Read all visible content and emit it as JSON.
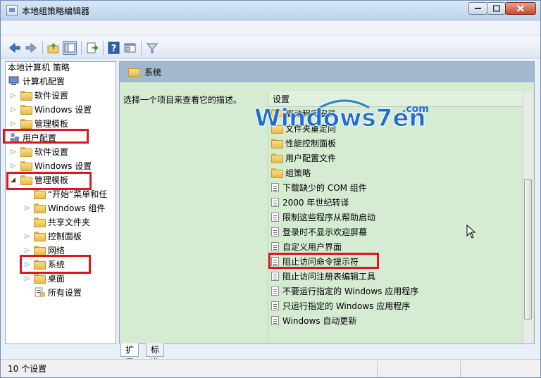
{
  "window": {
    "title": "本地组策略编辑器"
  },
  "tree": {
    "root": "本地计算机 策略",
    "items": [
      {
        "label": "计算机配置"
      },
      {
        "label": "软件设置"
      },
      {
        "label": "Windows 设置"
      },
      {
        "label": "管理模板"
      },
      {
        "label": "用户配置"
      },
      {
        "label": "软件设置"
      },
      {
        "label": "Windows 设置"
      },
      {
        "label": "管理模板"
      },
      {
        "label": "“开始”菜单和任"
      },
      {
        "label": "Windows 组件"
      },
      {
        "label": "共享文件夹"
      },
      {
        "label": "控制面板"
      },
      {
        "label": "网络"
      },
      {
        "label": "系统"
      },
      {
        "label": "桌面"
      },
      {
        "label": "所有设置"
      }
    ]
  },
  "right": {
    "header": "系统",
    "description": "选择一个项目来查看它的描述。",
    "column_header": "设置",
    "partial_item": "驱动程序安装",
    "items": [
      {
        "label": "文件夹重定向",
        "kind": "folder"
      },
      {
        "label": "性能控制面板",
        "kind": "folder"
      },
      {
        "label": "用户配置文件",
        "kind": "folder"
      },
      {
        "label": "组策略",
        "kind": "folder"
      },
      {
        "label": "下载缺少的 COM 组件",
        "kind": "setting"
      },
      {
        "label": "2000 年世纪转译",
        "kind": "setting"
      },
      {
        "label": "限制这些程序从帮助启动",
        "kind": "setting"
      },
      {
        "label": "登录时不显示欢迎屏幕",
        "kind": "setting"
      },
      {
        "label": "自定义用户界面",
        "kind": "setting"
      },
      {
        "label": "阻止访问命令提示符",
        "kind": "setting"
      },
      {
        "label": "阻止访问注册表编辑工具",
        "kind": "setting"
      },
      {
        "label": "不要运行指定的 Windows 应用程序",
        "kind": "setting"
      },
      {
        "label": "只运行指定的 Windows 应用程序",
        "kind": "setting"
      },
      {
        "label": "Windows 自动更新",
        "kind": "setting"
      }
    ]
  },
  "tabs": [
    {
      "label": "扩展"
    },
    {
      "label": "标准"
    }
  ],
  "status": {
    "text": "10 个设置"
  },
  "watermark": {
    "text": "Windows7en",
    "sub": ".com"
  },
  "colors": {
    "highlight_box": "#e01520",
    "pane_green": "#d5ecd3",
    "header_blue": "#a1b8cf"
  }
}
